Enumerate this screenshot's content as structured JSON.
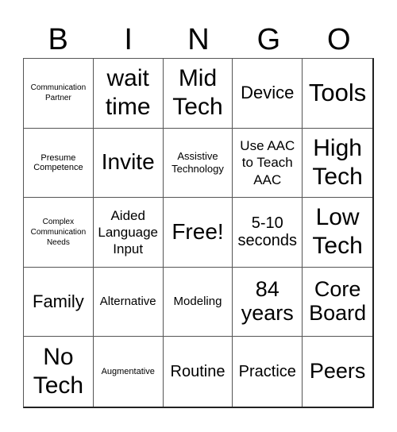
{
  "header": [
    "B",
    "I",
    "N",
    "G",
    "O"
  ],
  "cells": [
    "Communication Partner",
    "wait time",
    "Mid Tech",
    "Device",
    "Tools",
    "Presume Competence",
    "Invite",
    "Assistive Technology",
    "Use AAC to Teach AAC",
    "High Tech",
    "Complex Communication Needs",
    "Aided Language Input",
    "Free!",
    "5-10 seconds",
    "Low Tech",
    "Family",
    "Alternative",
    "Modeling",
    "84 years",
    "Core Board",
    "No Tech",
    "Augmentative",
    "Routine",
    "Practice",
    "Peers"
  ]
}
